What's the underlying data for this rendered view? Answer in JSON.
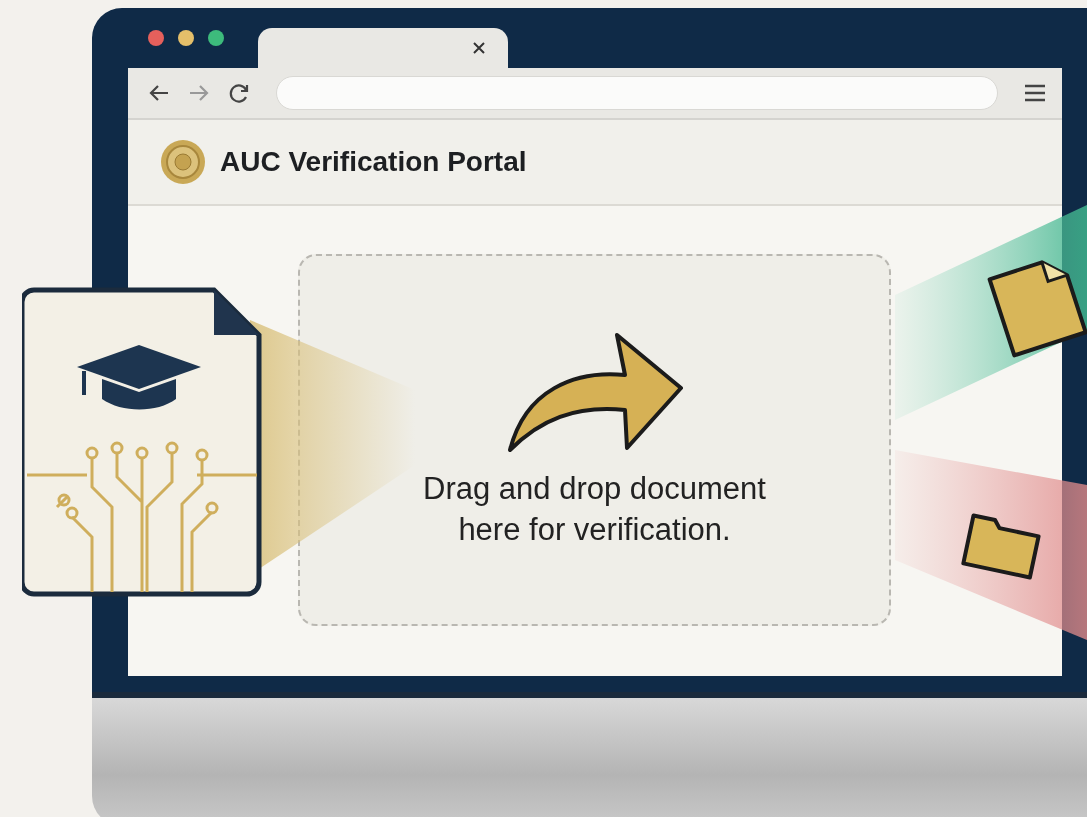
{
  "portal": {
    "title": "AUC Verification Portal"
  },
  "drop_zone": {
    "instruction": "Drag and drop document here for verification."
  }
}
